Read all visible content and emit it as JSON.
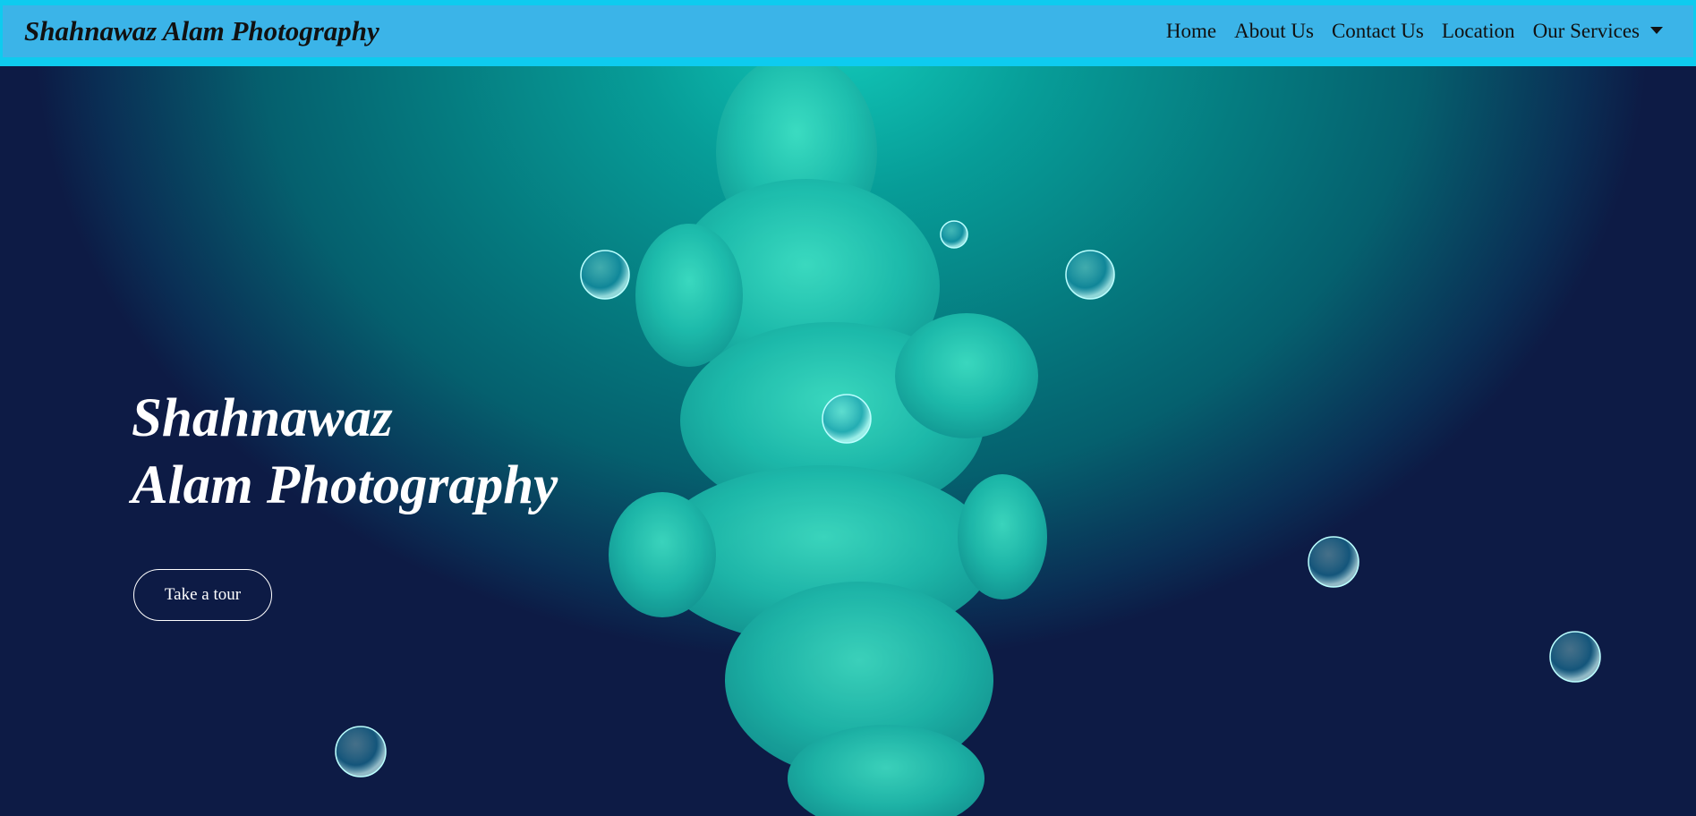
{
  "navbar": {
    "brand": "Shahnawaz Alam Photography",
    "links": [
      "Home",
      "About Us",
      "Contact Us",
      "Location",
      "Our Services"
    ]
  },
  "hero": {
    "title_line1": "Shahnawaz",
    "title_line2": "Alam Photography",
    "cta": "Take a tour"
  },
  "colors": {
    "navbar": "#3bb4e8",
    "navbar_border": "#0ecbef",
    "smoke": "#20c9b3"
  }
}
